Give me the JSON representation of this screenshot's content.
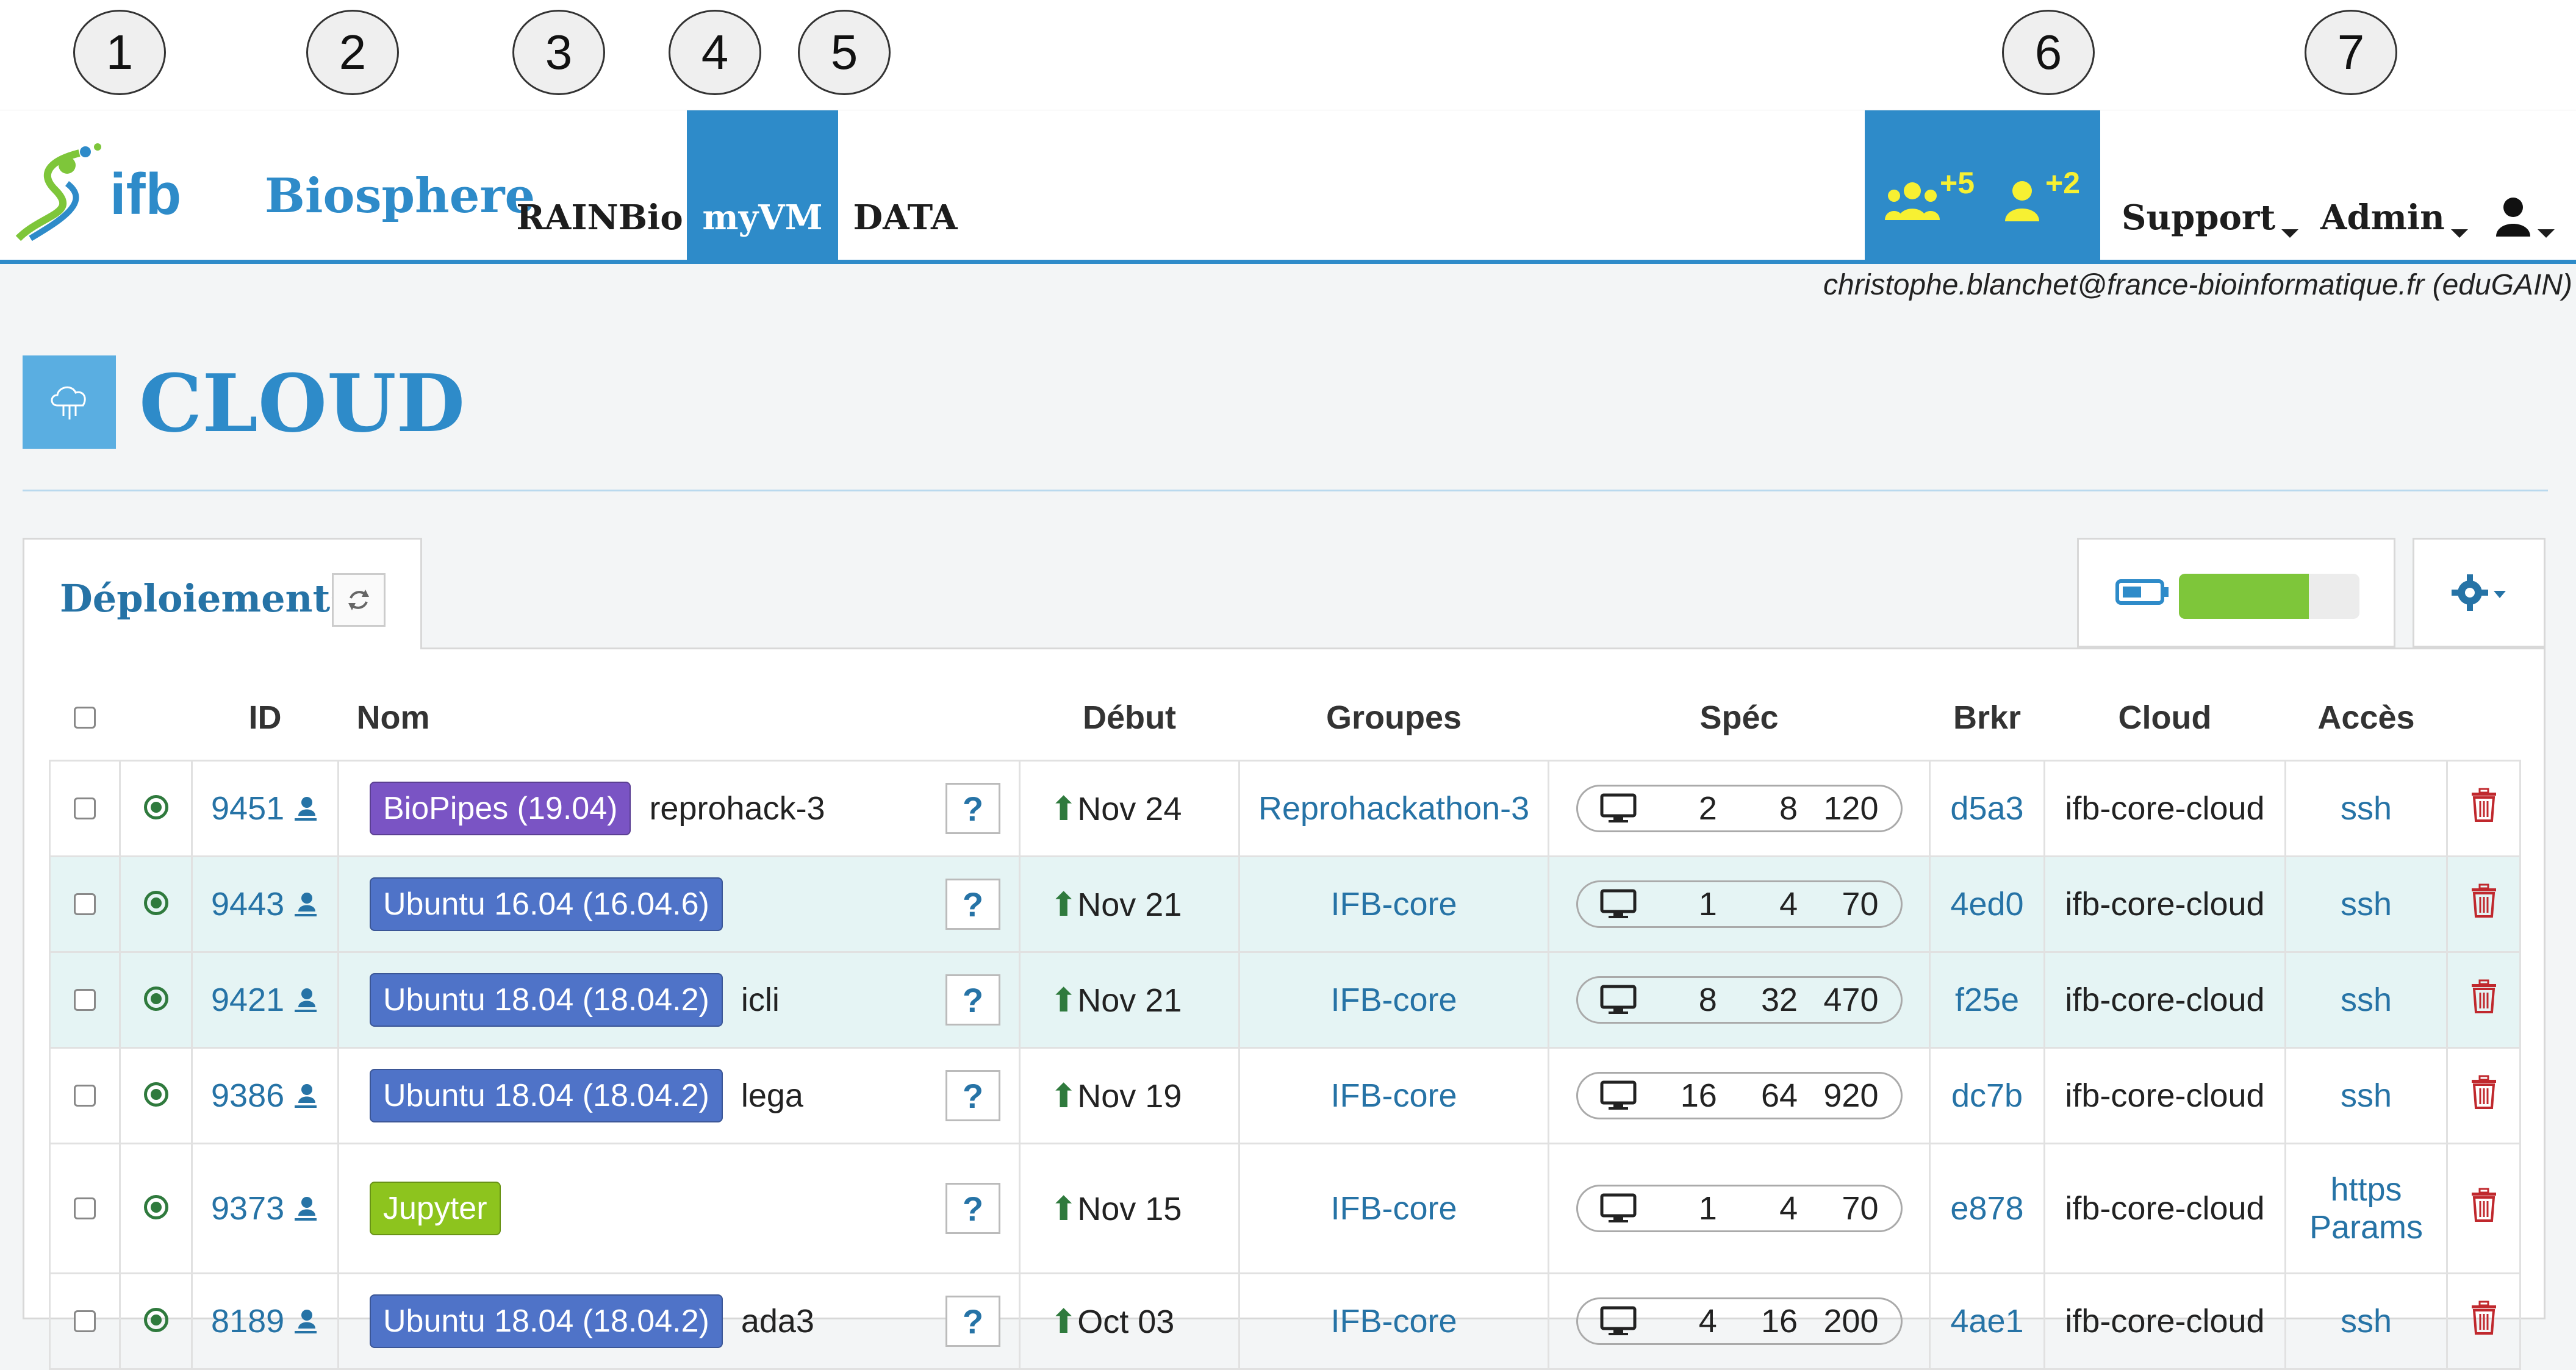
{
  "callouts": [
    "1",
    "2",
    "3",
    "4",
    "5",
    "6",
    "7"
  ],
  "nav": {
    "brand": "Biosphere",
    "links": [
      "RAINBio",
      "myVM",
      "DATA"
    ],
    "notif_groups": "+5",
    "notif_users": "+2",
    "support": "Support",
    "admin": "Admin"
  },
  "user_email": "christophe.blanchet@france-bioinformatique.fr (eduGAIN)",
  "page": {
    "title": "CLOUD"
  },
  "tab": {
    "label": "Déploiements"
  },
  "quota": {
    "fill": 0.72
  },
  "colors": {
    "accent": "#2e8bc9",
    "quota_fill": "#7ec63a",
    "running": "#2f7a3d",
    "delete": "#c0282d"
  },
  "table": {
    "headers": [
      "ID",
      "Nom",
      "Début",
      "Groupes",
      "Spéc",
      "Brkr",
      "Cloud",
      "Accès"
    ],
    "rows": [
      {
        "id": "9451",
        "badge": "BioPipes (19.04)",
        "badge_color": "purple",
        "name": "reprohack-3",
        "start": "Nov 24",
        "group": "Reprohackathon-3",
        "cpu": "2",
        "ram": "8",
        "disk": "120",
        "brkr": "d5a3",
        "cloud": "ifb-core-cloud",
        "access": "ssh",
        "access2": ""
      },
      {
        "id": "9443",
        "badge": "Ubuntu 16.04 (16.04.6)",
        "badge_color": "blue",
        "name": "",
        "start": "Nov 21",
        "group": "IFB-core",
        "cpu": "1",
        "ram": "4",
        "disk": "70",
        "brkr": "4ed0",
        "cloud": "ifb-core-cloud",
        "access": "ssh",
        "access2": ""
      },
      {
        "id": "9421",
        "badge": "Ubuntu 18.04 (18.04.2)",
        "badge_color": "blue",
        "name": "icli",
        "start": "Nov 21",
        "group": "IFB-core",
        "cpu": "8",
        "ram": "32",
        "disk": "470",
        "brkr": "f25e",
        "cloud": "ifb-core-cloud",
        "access": "ssh",
        "access2": ""
      },
      {
        "id": "9386",
        "badge": "Ubuntu 18.04 (18.04.2)",
        "badge_color": "blue",
        "name": "lega",
        "start": "Nov 19",
        "group": "IFB-core",
        "cpu": "16",
        "ram": "64",
        "disk": "920",
        "brkr": "dc7b",
        "cloud": "ifb-core-cloud",
        "access": "ssh",
        "access2": ""
      },
      {
        "id": "9373",
        "badge": "Jupyter",
        "badge_color": "green",
        "name": "",
        "start": "Nov 15",
        "group": "IFB-core",
        "cpu": "1",
        "ram": "4",
        "disk": "70",
        "brkr": "e878",
        "cloud": "ifb-core-cloud",
        "access": "https",
        "access2": "Params"
      },
      {
        "id": "8189",
        "badge": "Ubuntu 18.04 (18.04.2)",
        "badge_color": "blue",
        "name": "ada3",
        "start": "Oct 03",
        "group": "IFB-core",
        "cpu": "4",
        "ram": "16",
        "disk": "200",
        "brkr": "4ae1",
        "cloud": "ifb-core-cloud",
        "access": "ssh",
        "access2": ""
      }
    ]
  }
}
